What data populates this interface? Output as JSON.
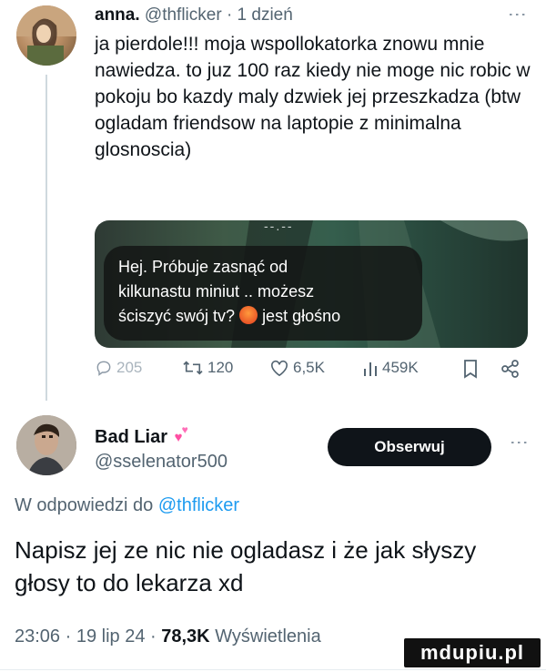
{
  "tweet1": {
    "name": "anna.",
    "handle": "@thflicker",
    "separator": "·",
    "time": "1 dzień",
    "text": "ja pierdole!!! moja wspollokatorka znowu mnie nawiedza. to juz 100 raz kiedy nie moge nic robic w pokoju bo kazdy maly dzwiek jej przeszkadza (btw ogladam friendsow na laptopie z minimalna glosnoscia)",
    "media": {
      "top_text": "--.--",
      "message_line1": "Hej. Próbuje zasnąć od",
      "message_line2": "kilkunastu miniut .. możesz",
      "message_line3_a": "ściszyć swój tv?",
      "message_line3_b": " jest głośno"
    },
    "actions": {
      "replies": "205",
      "retweets": "120",
      "likes": "6,5K",
      "views": "459K"
    }
  },
  "tweet2": {
    "name": "Bad Liar",
    "handle": "@sselenator500",
    "follow_label": "Obserwuj",
    "reply_prefix": "W odpowiedzi do",
    "reply_mention": "@thflicker",
    "text": "Napisz jej ze nic nie ogladasz i że jak słyszy głosy to do lekarza xd",
    "time": "23:06",
    "date": "19 lip 24",
    "views_count": "78,3K",
    "views_label": "Wyświetlenia"
  },
  "watermark": "mdupiu.pl",
  "colors": {
    "text": "#0f1419",
    "secondary": "#536471",
    "link": "#1d9bf0",
    "button_bg": "#0f1419"
  }
}
